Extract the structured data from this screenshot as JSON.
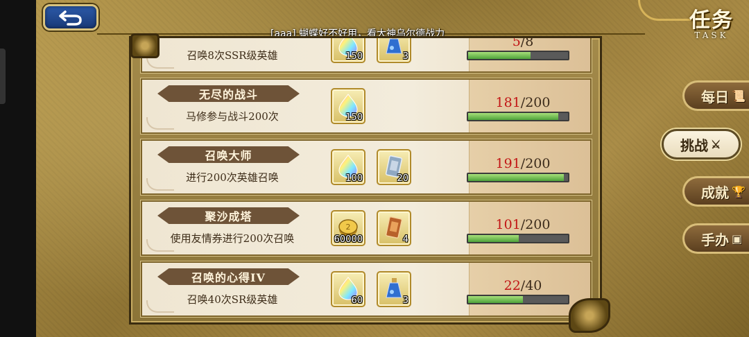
{
  "header": {
    "title": "任务",
    "subtitle": "TASK",
    "back_icon": "return-arrow-icon",
    "marquee": "[aaa] 蝴蝶好不好用，看大神乌尔德战力"
  },
  "tasks": [
    {
      "title": "",
      "desc": "召唤8次SSR级英雄",
      "rewards": [
        {
          "icon": "rainbow-crystal-icon",
          "count": "150"
        },
        {
          "icon": "blue-potion-icon",
          "count": "3"
        }
      ],
      "current": "5",
      "total": "/8",
      "fraction": 0.625
    },
    {
      "title": "无尽的战斗",
      "desc": "马修参与战斗200次",
      "rewards": [
        {
          "icon": "rainbow-crystal-icon",
          "count": "150"
        }
      ],
      "current": "181",
      "total": "/200",
      "fraction": 0.905
    },
    {
      "title": "召唤大师",
      "desc": "进行200次英雄召唤",
      "rewards": [
        {
          "icon": "rainbow-crystal-icon",
          "count": "100"
        },
        {
          "icon": "silver-ticket-icon",
          "count": "20"
        }
      ],
      "current": "191",
      "total": "/200",
      "fraction": 0.955
    },
    {
      "title": "聚沙成塔",
      "desc": "使用友情券进行200次召唤",
      "rewards": [
        {
          "icon": "gold-coin-icon",
          "count": "60000"
        },
        {
          "icon": "bronze-ticket-icon",
          "count": "4"
        }
      ],
      "current": "101",
      "total": "/200",
      "fraction": 0.505
    },
    {
      "title": "召唤的心得IV",
      "desc": "召唤40次SR级英雄",
      "rewards": [
        {
          "icon": "rainbow-crystal-icon",
          "count": "60"
        },
        {
          "icon": "blue-potion-icon",
          "count": "3"
        }
      ],
      "current": "22",
      "total": "/40",
      "fraction": 0.55
    }
  ],
  "side_tabs": [
    {
      "label": "每日",
      "icon": "scroll-icon",
      "glyph": "📜",
      "active": false
    },
    {
      "label": "挑战",
      "icon": "crossed-swords-icon",
      "glyph": "⚔",
      "active": true
    },
    {
      "label": "成就",
      "icon": "trophy-icon",
      "glyph": "🏆",
      "active": false
    },
    {
      "label": "手办",
      "icon": "figure-icon",
      "glyph": "▣",
      "active": false
    }
  ]
}
